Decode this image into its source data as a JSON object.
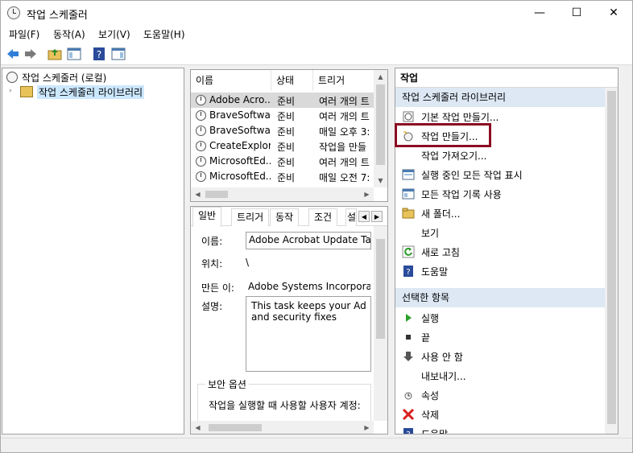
{
  "window": {
    "title": "작업 스케줄러"
  },
  "menu": [
    "파일(F)",
    "동작(A)",
    "보기(V)",
    "도움말(H)"
  ],
  "tree": {
    "root": "작업 스케줄러 (로컬)",
    "child": "작업 스케줄러 라이브러리"
  },
  "task_list": {
    "columns": [
      "이름",
      "상태",
      "트리거"
    ],
    "rows": [
      {
        "name": "Adobe Acro...",
        "status": "준비",
        "trigger": "여러 개의 트"
      },
      {
        "name": "BraveSoftwa...",
        "status": "준비",
        "trigger": "여러 개의 트"
      },
      {
        "name": "BraveSoftwa...",
        "status": "준비",
        "trigger": "매일 오후 3:"
      },
      {
        "name": "CreateExplor...",
        "status": "준비",
        "trigger": "작업을 만들"
      },
      {
        "name": "MicrosoftEd...",
        "status": "준비",
        "trigger": "여러 개의 트"
      },
      {
        "name": "MicrosoftEd...",
        "status": "준비",
        "trigger": "매일 오전 7:"
      }
    ]
  },
  "detail": {
    "tabs": [
      "일반",
      "트리거",
      "동작",
      "조건",
      "설"
    ],
    "name_label": "이름:",
    "name_value": "Adobe Acrobat Update Task",
    "location_label": "위치:",
    "location_value": "\\",
    "author_label": "만든 이:",
    "author_value": "Adobe Systems Incorporated",
    "description_label": "설명:",
    "description_value_line1": "This task keeps your Adobe R",
    "description_value_line2": "and security fixes",
    "security_group": "보안 옵션",
    "security_text": "작업을 실행할 때 사용할 사용자 계정:"
  },
  "actions": {
    "title": "작업",
    "section1": "작업 스케줄러 라이브러리",
    "items1": [
      {
        "label": "기본 작업 만들기...",
        "icon": "basic-task-icon"
      },
      {
        "label": "작업 만들기...",
        "icon": "create-task-icon"
      },
      {
        "label": "작업 가져오기...",
        "icon": ""
      },
      {
        "label": "실행 중인 모든 작업 표시",
        "icon": "running-tasks-icon"
      },
      {
        "label": "모든 작업 기록 사용",
        "icon": "history-icon"
      },
      {
        "label": "새 폴더...",
        "icon": "folder-icon"
      },
      {
        "label": "보기",
        "icon": ""
      },
      {
        "label": "새로 고침",
        "icon": "refresh-icon"
      },
      {
        "label": "도움말",
        "icon": "help-icon"
      }
    ],
    "section2": "선택한 항목",
    "items2": [
      {
        "label": "실행",
        "icon": "run-icon"
      },
      {
        "label": "끝",
        "icon": "stop-icon"
      },
      {
        "label": "사용 안 함",
        "icon": "disable-icon"
      },
      {
        "label": "내보내기...",
        "icon": ""
      },
      {
        "label": "속성",
        "icon": "properties-icon"
      },
      {
        "label": "삭제",
        "icon": "delete-icon"
      },
      {
        "label": "도움말",
        "icon": "help-icon"
      }
    ]
  },
  "colors": {
    "highlight": "#8b0a22",
    "section_bg": "#dde8f4",
    "selection": "#cce8ff"
  }
}
